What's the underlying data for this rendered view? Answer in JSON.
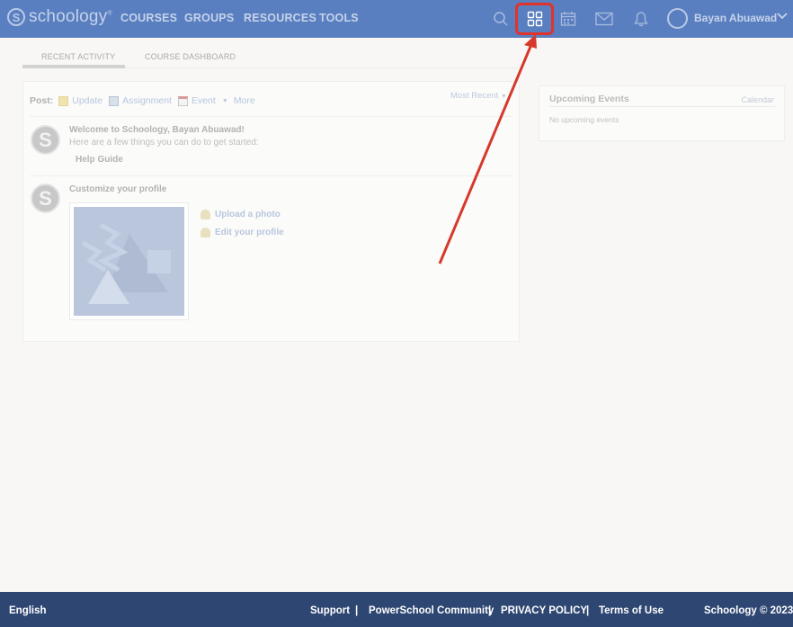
{
  "header": {
    "logo_text": "schoology",
    "logo_mark": "S",
    "nav": [
      "COURSES",
      "GROUPS",
      "RESOURCES",
      "TOOLS"
    ],
    "user_name": "Bayan Abuawad",
    "icons": [
      "search-icon",
      "apps-grid-icon",
      "calendar-icon",
      "mail-icon",
      "notification-bell-icon"
    ],
    "highlight_color": "#e0332c"
  },
  "tabs": [
    "RECENT ACTIVITY",
    "COURSE DASHBOARD"
  ],
  "post_bar": {
    "label": "Post:",
    "options": [
      "Update",
      "Assignment",
      "Event",
      "More"
    ],
    "sort": "Most Recent"
  },
  "feed": {
    "welcome_title": "Welcome to Schoology, Bayan Abuawad!",
    "welcome_sub": "Here are a few things you can do to get started:",
    "help_guide": "Help Guide",
    "profile_title": "Customize your profile",
    "upload_photo": "Upload a photo",
    "edit_profile": "Edit your profile"
  },
  "side": {
    "title": "Upcoming Events",
    "calendar_link": "Calendar",
    "empty": "No upcoming events"
  },
  "footer": {
    "language": "English",
    "links": [
      "Support",
      "PowerSchool Community",
      "PRIVACY POLICY",
      "Terms of Use"
    ],
    "separator": "|",
    "copyright": "Schoology © 2023"
  },
  "colors": {
    "header_bg": "#5a7fc0",
    "footer_bg": "#2e4672",
    "arrow": "#d6392c"
  }
}
